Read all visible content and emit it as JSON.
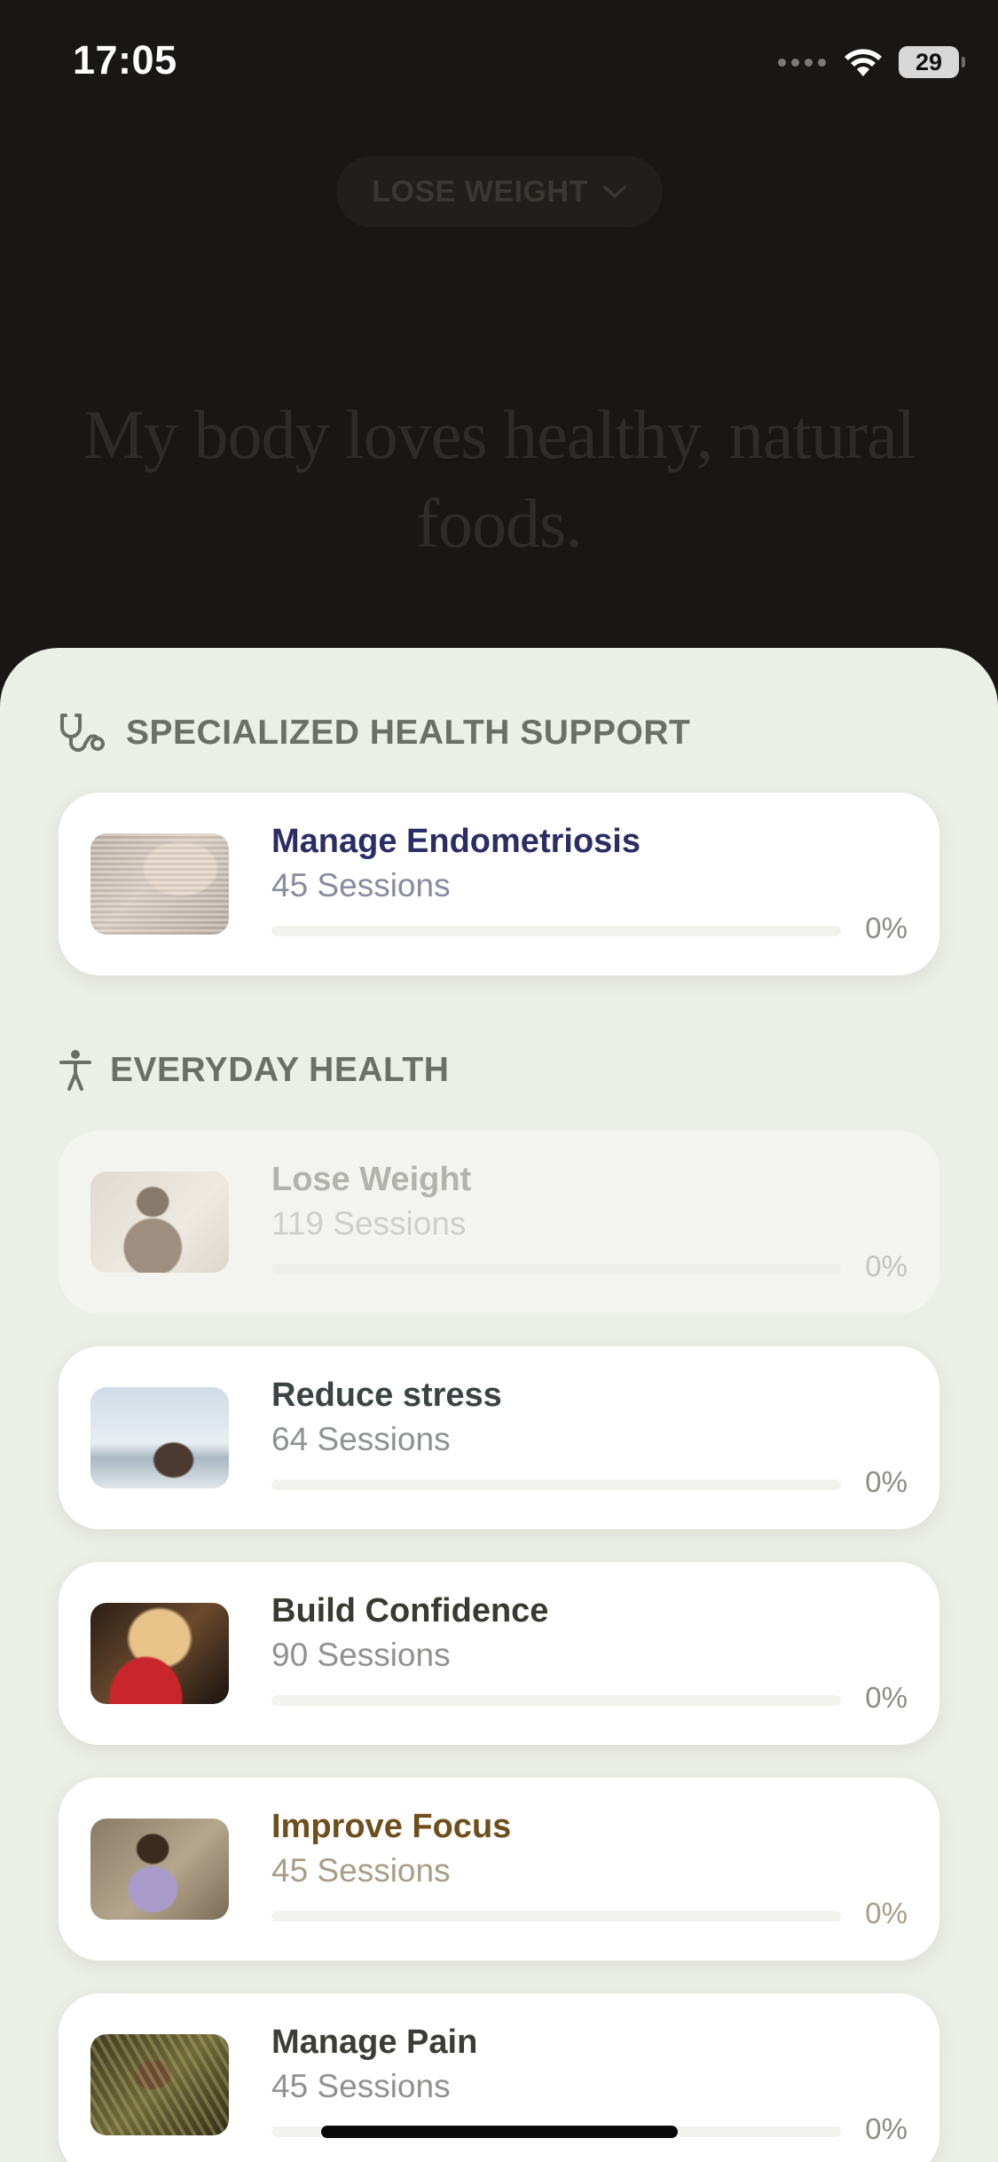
{
  "status_bar": {
    "time": "17:05",
    "battery": "29"
  },
  "header": {
    "goal_selector_label": "LOSE WEIGHT",
    "affirmation": "My body loves healthy, natural foods."
  },
  "sections": [
    {
      "title": "SPECIALIZED HEALTH SUPPORT",
      "icon": "stethoscope-icon",
      "programs": [
        {
          "title": "Manage Endometriosis",
          "sessions": "45 Sessions",
          "percent": "0%",
          "progress": 0,
          "title_color": "#2c2c66",
          "sessions_color": "#8a8aa0"
        }
      ]
    },
    {
      "title": "EVERYDAY HEALTH",
      "icon": "person-arms-out-icon",
      "programs": [
        {
          "title": "Lose Weight",
          "sessions": "119 Sessions",
          "percent": "0%",
          "progress": 0,
          "title_color": "#b3b3ae",
          "sessions_color": "#cfcfca",
          "selected": true
        },
        {
          "title": "Reduce stress",
          "sessions": "64 Sessions",
          "percent": "0%",
          "progress": 0,
          "title_color": "#3d4244",
          "sessions_color": "#8e9192"
        },
        {
          "title": "Build Confidence",
          "sessions": "90 Sessions",
          "percent": "0%",
          "progress": 0,
          "title_color": "#3a3a34",
          "sessions_color": "#919190"
        },
        {
          "title": "Improve Focus",
          "sessions": "45 Sessions",
          "percent": "0%",
          "progress": 0,
          "title_color": "#6e4f1c",
          "sessions_color": "#a89d88"
        },
        {
          "title": "Manage Pain",
          "sessions": "45 Sessions",
          "percent": "0%",
          "progress": 0,
          "title_color": "#3c3c38",
          "sessions_color": "#919190"
        }
      ]
    }
  ],
  "colors": {
    "background": "#191715",
    "sheet": "#eceee8",
    "card": "#ffffff"
  }
}
